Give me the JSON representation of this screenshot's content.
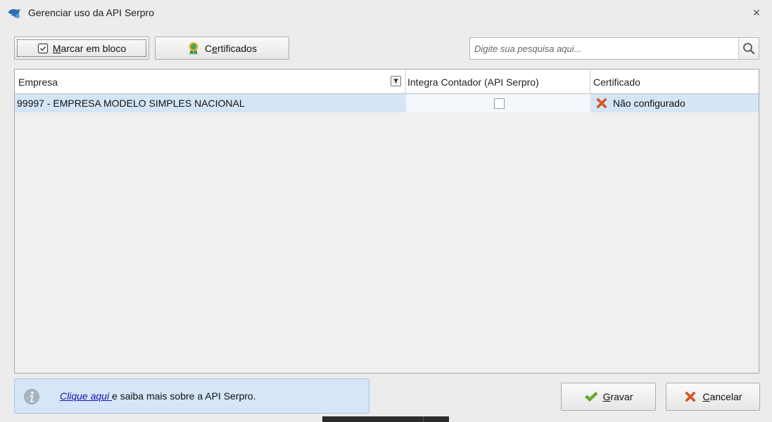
{
  "window": {
    "title": "Gerenciar uso da API Serpro",
    "close_glyph": "✕"
  },
  "toolbar": {
    "marcar": {
      "pre": "",
      "accel": "M",
      "post": "arcar em bloco"
    },
    "certificados": {
      "pre": "C",
      "accel": "e",
      "post": "rtificados"
    }
  },
  "search": {
    "placeholder": "Digite sua pesquisa aqui..."
  },
  "grid": {
    "columns": [
      "Empresa",
      "Integra Contador (API Serpro)",
      "Certificado"
    ],
    "rows": [
      {
        "empresa": "99997 - EMPRESA MODELO SIMPLES NACIONAL",
        "integra": false,
        "certificado": "Não configurado"
      }
    ]
  },
  "info": {
    "link": "Clique aqui ",
    "text": "e saiba mais sobre a API Serpro."
  },
  "buttons": {
    "gravar": {
      "accel": "G",
      "post": "ravar"
    },
    "cancelar": {
      "accel": "C",
      "post": "ancelar"
    }
  },
  "colors": {
    "row_selected": "#d4e5f6",
    "info_bg": "#d5e6f8",
    "link": "#1a0dab",
    "error_x": "#e05a1c",
    "check_green": "#6ab023"
  },
  "icons": [
    "serpro-app-icon",
    "close-icon",
    "checkbox-icon",
    "certificate-icon",
    "search-icon",
    "filter-icon",
    "error-x-icon",
    "info-icon",
    "checkmark-icon",
    "cancel-x-icon"
  ]
}
